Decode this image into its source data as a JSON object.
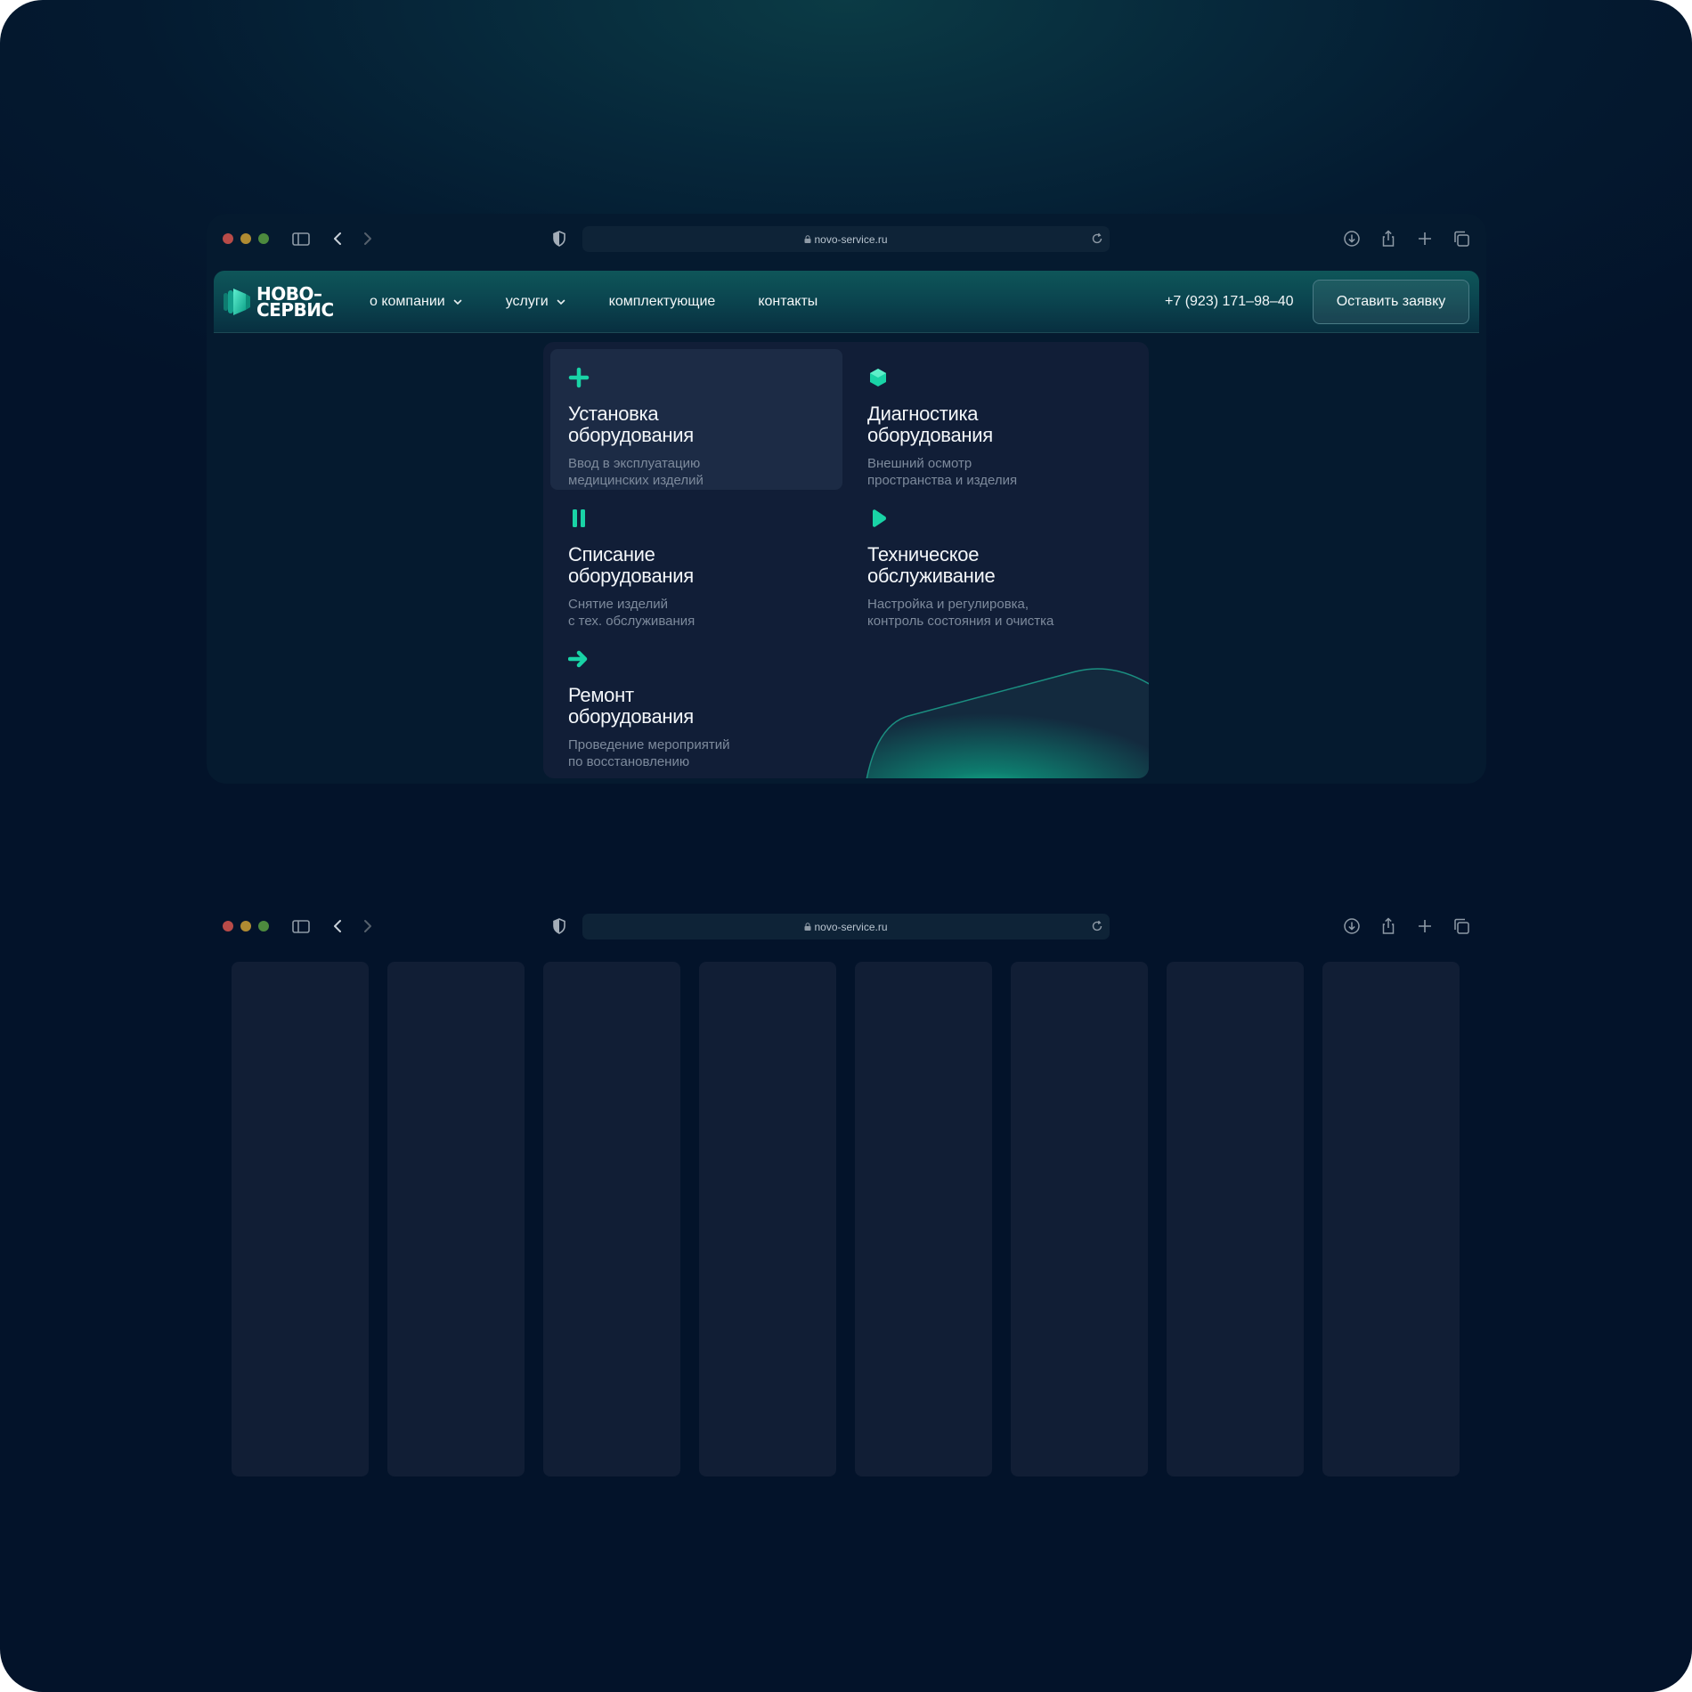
{
  "windows": [
    {
      "url": "novo-service.ru",
      "nav": {
        "logo_line1": "НОВО–",
        "logo_line2": "СЕРВИС",
        "links": [
          {
            "label": "о компании",
            "has_dropdown": true
          },
          {
            "label": "услуги",
            "has_dropdown": true
          },
          {
            "label": "комплектующие",
            "has_dropdown": false
          },
          {
            "label": "контакты",
            "has_dropdown": false
          }
        ],
        "phone": "+7 (923) 171–98–40",
        "cta": "Оставить заявку"
      },
      "services_menu": [
        {
          "icon": "plus-icon",
          "title_l1": "Установка",
          "title_l2": "оборудования",
          "sub_l1": "Ввод в эксплуатацию",
          "sub_l2": "медицинских изделий",
          "active": true
        },
        {
          "icon": "hexagon-icon",
          "title_l1": "Диагностика",
          "title_l2": "оборудования",
          "sub_l1": "Внешний осмотр",
          "sub_l2": "пространства и изделия",
          "active": false
        },
        {
          "icon": "pause-icon",
          "title_l1": "Списание",
          "title_l2": "оборудования",
          "sub_l1": "Снятие изделий",
          "sub_l2": "с тех. обслуживания",
          "active": false
        },
        {
          "icon": "play-icon",
          "title_l1": "Техническое",
          "title_l2": "обслуживание",
          "sub_l1": "Настройка и регулировка,",
          "sub_l2": "контроль состояния и очистка",
          "active": false
        },
        {
          "icon": "arrow-right-icon",
          "title_l1": "Ремонт",
          "title_l2": "оборудования",
          "sub_l1": "Проведение мероприятий",
          "sub_l2": "по восстановлению",
          "active": false
        }
      ]
    },
    {
      "url": "novo-service.ru",
      "placeholder_cards": 8
    }
  ],
  "colors": {
    "accent": "#19d3a6",
    "background": "#03132a",
    "panel": "#111e37",
    "muted_text": "#7d8a9c"
  }
}
